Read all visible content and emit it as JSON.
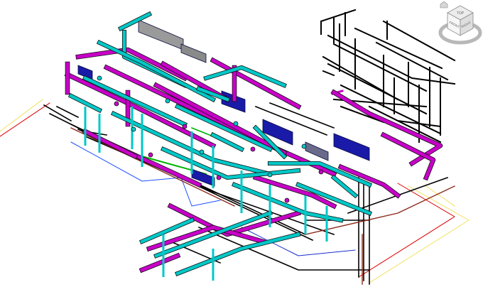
{
  "view": {
    "background": "#ffffff",
    "system_colors": {
      "supply_duct": "#00c8c8",
      "return_duct": "#c800c8",
      "equipment": "#1a1aa8",
      "piping": "#000000",
      "sprinkler": "#00b400",
      "steel_highlight": "#8b2a1a",
      "grid_red": "#e00000",
      "grid_yellow": "#f0e060",
      "plan_blue": "#1e50ff"
    }
  },
  "viewcube": {
    "top_label": "TOP",
    "front_label": "FRONT",
    "right_label": "RIGHT",
    "icon": "viewcube-icon",
    "home_icon": "home-icon"
  }
}
